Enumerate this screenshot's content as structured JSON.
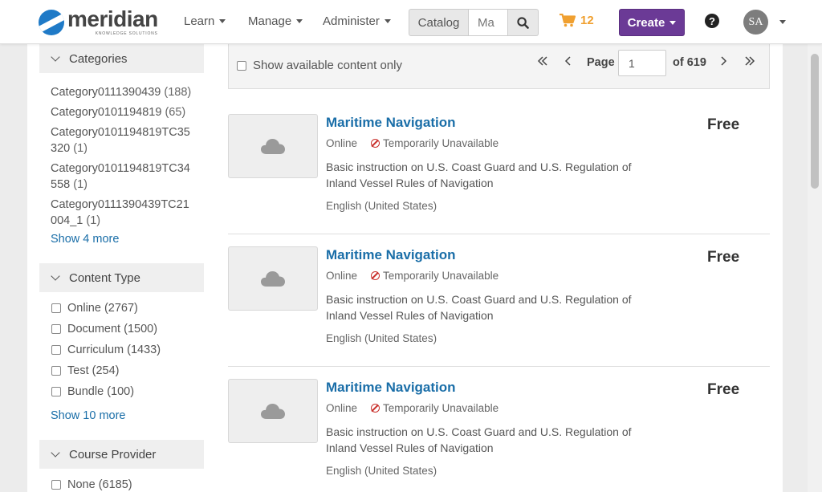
{
  "app": {
    "logo_word": "meridian",
    "logo_sub": "KNOWLEDGE SOLUTIONS"
  },
  "nav": {
    "learn": "Learn",
    "manage": "Manage",
    "administer": "Administer",
    "catalog_label": "Catalog",
    "catalog_value": "Ma",
    "cart_count": "12",
    "create": "Create",
    "help": "?",
    "avatar_initials": "SA"
  },
  "sidebar": {
    "categories": {
      "header": "Categories",
      "items": [
        {
          "name": "Category0111390439",
          "count": "(188)"
        },
        {
          "name": "Category0101194819",
          "count": "(65)"
        },
        {
          "name": "Category0101194819TC35320",
          "count": "(1)"
        },
        {
          "name": "Category0101194819TC34558",
          "count": "(1)"
        },
        {
          "name": "Category0111390439TC21004_1",
          "count": "(1)"
        }
      ],
      "show_more": "Show 4 more"
    },
    "content_type": {
      "header": "Content Type",
      "items": [
        {
          "name": "Online",
          "count": "(2767)"
        },
        {
          "name": "Document",
          "count": "(1500)"
        },
        {
          "name": "Curriculum",
          "count": "(1433)"
        },
        {
          "name": "Test",
          "count": "(254)"
        },
        {
          "name": "Bundle",
          "count": "(100)"
        }
      ],
      "show_more": "Show 10 more"
    },
    "course_provider": {
      "header": "Course Provider",
      "items": [
        {
          "name": "None",
          "count": "(6185)"
        }
      ]
    }
  },
  "toolbar": {
    "available_only": "Show available content only",
    "page_label": "Page",
    "page_value": "1",
    "page_of": "of 619"
  },
  "courses": [
    {
      "title": "Maritime Navigation",
      "delivery": "Online",
      "status": "Temporarily Unavailable",
      "description": "Basic instruction on U.S. Coast Guard and U.S. Regulation of Inland Vessel Rules of Navigation",
      "language": "English (United States)",
      "price": "Free"
    },
    {
      "title": "Maritime Navigation",
      "delivery": "Online",
      "status": "Temporarily Unavailable",
      "description": "Basic instruction on U.S. Coast Guard and U.S. Regulation of Inland Vessel Rules of Navigation",
      "language": "English (United States)",
      "price": "Free"
    },
    {
      "title": "Maritime Navigation",
      "delivery": "Online",
      "status": "Temporarily Unavailable",
      "description": "Basic instruction on U.S. Coast Guard and U.S. Regulation of Inland Vessel Rules of Navigation",
      "language": "English (United States)",
      "price": "Free"
    }
  ],
  "colors": {
    "brand_blue": "#1f7ac7",
    "link_blue": "#1a6ea8",
    "create_purple": "#6b3a96",
    "cart_orange": "#f0a030",
    "unavailable_red": "#c9302c"
  },
  "icons": {
    "logo": "meridian-logo-icon",
    "search": "search-icon",
    "cart": "shopping-cart-icon",
    "help": "question-circle-icon",
    "thumb": "cloud-icon"
  }
}
